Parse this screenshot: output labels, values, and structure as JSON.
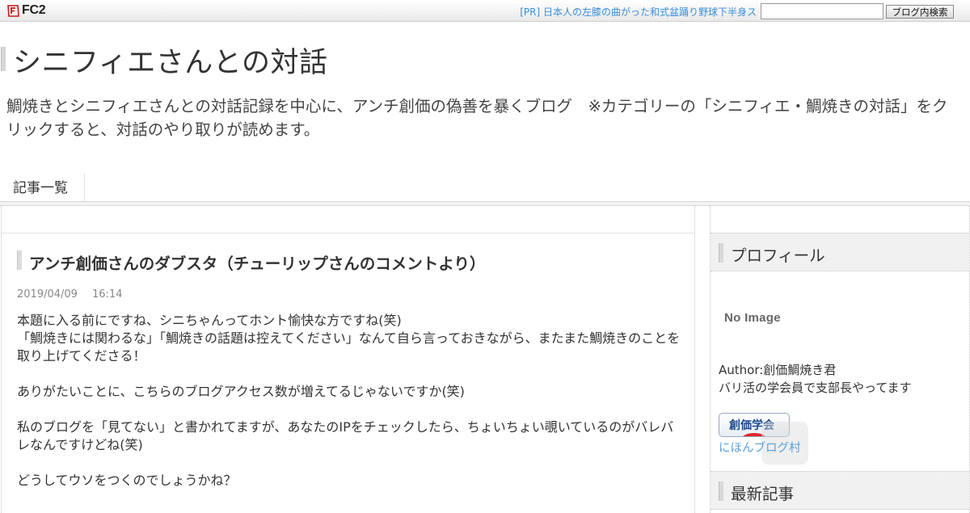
{
  "fc2bar": {
    "logo_text": "FC2",
    "pr_link": "[PR] 日本人の左膝の曲がった和式盆踊り野球下半身ス",
    "search_value": "",
    "search_button": "ブログ内検索"
  },
  "header": {
    "title": "シニフィエさんとの対話",
    "description": "鯛焼きとシニフィエさんとの対話記録を中心に、アンチ創価の偽善を暴くブログ　※カテゴリーの「シニフィエ・鯛焼きの対話」をクリックすると、対話のやり取りが読めます。"
  },
  "nav": {
    "items": [
      "記事一覧"
    ]
  },
  "entry": {
    "title": "アンチ創価さんのダブスタ（チューリップさんのコメントより）",
    "date": "2019/04/09",
    "time": "16:14",
    "paragraphs": [
      [
        "本題に入る前にですね、シニちゃんってホント愉快な方ですね(笑)",
        "「鯛焼きには関わるな」「鯛焼きの話題は控えてください」なんて自ら言っておきながら、またまた鯛焼きのことを取り上げてくださる！"
      ],
      [
        "ありがたいことに、こちらのブログアクセス数が増えてるじゃないですか(笑)"
      ],
      [
        "私のブログを「見てない」と書かれてますが、あなたのIPをチェックしたら、ちょいちょい覗いているのがバレバレなんですけどね(笑)"
      ],
      [
        "どうしてウソをつくのでしょうかね？"
      ]
    ]
  },
  "sidebar": {
    "profile_heading": "プロフィール",
    "no_image": "No Image",
    "author": "Author:創価鯛焼き君",
    "author_bio": "バリ活の学会員で支部長やってます",
    "banner_text": "創価学会",
    "banner_link": "にほんブログ村",
    "recent_heading": "最新記事"
  },
  "colors": {
    "link": "#3b8ed8",
    "text": "#333333",
    "date": "#888888",
    "banner_red": "#e0242a"
  }
}
